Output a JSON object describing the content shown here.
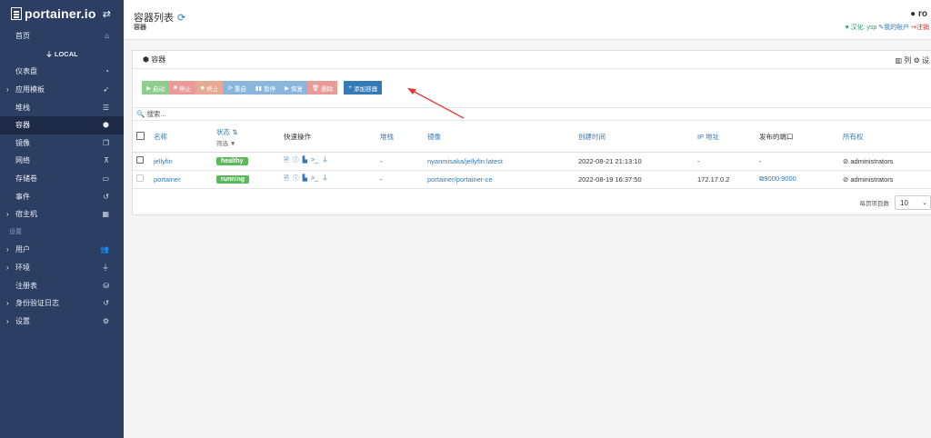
{
  "brand": {
    "name": "portainer.io"
  },
  "sidebar": {
    "items": [
      {
        "label": "首页",
        "icon": "home-icon",
        "glyph": "⌂"
      },
      {
        "label": "LOCAL",
        "icon": "plug-icon",
        "glyph": "⏚"
      },
      {
        "label": "仪表盘",
        "icon": "dashboard-icon",
        "glyph": "◔"
      },
      {
        "label": "应用模板",
        "icon": "rocket-icon",
        "glyph": "➶"
      },
      {
        "label": "堆栈",
        "icon": "list-icon",
        "glyph": "☰"
      },
      {
        "label": "容器",
        "icon": "cubes-icon",
        "glyph": "⬢"
      },
      {
        "label": "镜像",
        "icon": "clone-icon",
        "glyph": "❐"
      },
      {
        "label": "网络",
        "icon": "sitemap-icon",
        "glyph": "⊼"
      },
      {
        "label": "存储卷",
        "icon": "hdd-icon",
        "glyph": "▭"
      },
      {
        "label": "事件",
        "icon": "history-icon",
        "glyph": "↺"
      },
      {
        "label": "宿主机",
        "icon": "th-icon",
        "glyph": "▦"
      },
      {
        "label": "设置",
        "icon": "",
        "glyph": ""
      },
      {
        "label": "用户",
        "icon": "users-icon",
        "glyph": "👥"
      },
      {
        "label": "环境",
        "icon": "plug-icon",
        "glyph": "⏚"
      },
      {
        "label": "注册表",
        "icon": "database-icon",
        "glyph": "⛁"
      },
      {
        "label": "身份验证日志",
        "icon": "history-icon",
        "glyph": "↺"
      },
      {
        "label": "设置",
        "icon": "cogs-icon",
        "glyph": "⚙"
      }
    ]
  },
  "header": {
    "title": "容器列表",
    "breadcrumb": "容器",
    "user": "ro",
    "localization": "汉化: ysp",
    "my_account": "我的账户",
    "logout": "注销"
  },
  "panel": {
    "title": "容器",
    "columns_label": "列",
    "settings_label": "设"
  },
  "toolbar": {
    "start": "启动",
    "stop": "停止",
    "kill": "终止",
    "restart": "重启",
    "pause": "暂停",
    "resume": "恢复",
    "remove": "删除",
    "add": "添加容器"
  },
  "search": {
    "placeholder": "搜索..."
  },
  "table": {
    "headers": {
      "name": "名称",
      "state": "状态",
      "filter": "筛选",
      "quick_actions": "快速操作",
      "stack": "堆栈",
      "image": "镜像",
      "created": "创建时间",
      "ip": "IP 地址",
      "ports": "发布的端口",
      "ownership": "所有权"
    },
    "rows": [
      {
        "name": "jellyfin",
        "state": "healthy",
        "stack": "-",
        "image": "nyanmisaka/jellyfin:latest",
        "created": "2022-08-21 21:13:10",
        "ip": "-",
        "ports": "-",
        "ownership": "administrators"
      },
      {
        "name": "portainer",
        "state": "running",
        "stack": "-",
        "image": "portainer/portainer-ce",
        "created": "2022-08-19 16:37:50",
        "ip": "172.17.0.2",
        "ports": "9000:9000",
        "ownership": "administrators"
      }
    ]
  },
  "pagination": {
    "label": "每页项目数",
    "value": "10"
  },
  "colors": {
    "sidebar": "#2d3e63",
    "accent": "#337ab7",
    "healthy": "#5cb85c",
    "arrow": "#e03a3a"
  }
}
